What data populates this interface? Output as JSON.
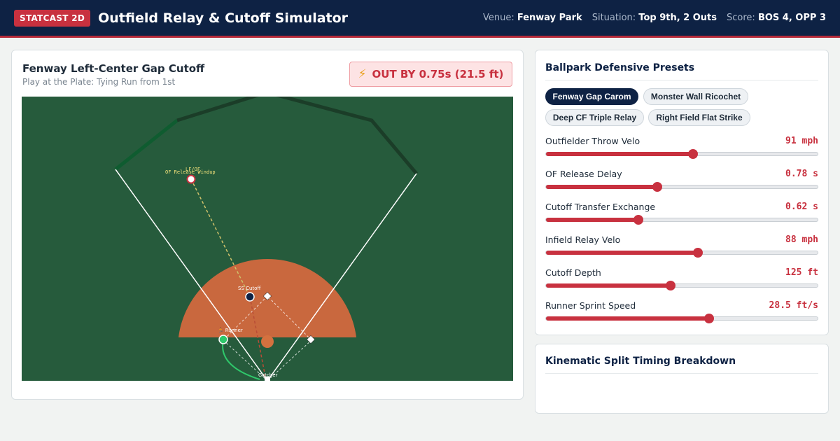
{
  "header": {
    "badge": "STATCAST 2D",
    "title": "Outfield Relay & Cutoff Simulator",
    "venue_label": "Venue:",
    "venue": "Fenway Park",
    "situation_label": "Situation:",
    "situation": "Top 9th, 2 Outs",
    "score_label": "Score:",
    "score": "BOS 4, OPP 3"
  },
  "play": {
    "title": "Fenway Left-Center Gap Cutoff",
    "subtitle": "Play at the Plate: Tying Run from 1st",
    "result": "OUT BY 0.75s (21.5 ft)",
    "result_icon": "lightning-icon"
  },
  "field": {
    "labels": {
      "of_release": "OF Release Windup",
      "lf_of": "LF/OF",
      "ss_cutoff": "SS Cutoff",
      "runner": "Runner",
      "catcher": "Catcher"
    },
    "colors": {
      "grass": "#265b3c",
      "dirt": "#c9683e",
      "wall": "#1b3d28",
      "monster": "#0f5c30",
      "runner_path": "#2fc86b",
      "throw_of": "#cfc06a",
      "throw_relay": "#b84c36"
    }
  },
  "presets": {
    "title": "Ballpark Defensive Presets",
    "items": [
      "Fenway Gap Carom",
      "Monster Wall Ricochet",
      "Deep CF Triple Relay",
      "Right Field Flat Strike"
    ],
    "active": "Fenway Gap Carom"
  },
  "sliders": [
    {
      "label": "Outfielder Throw Velo",
      "value": "91 mph",
      "fraction": 0.54
    },
    {
      "label": "OF Release Delay",
      "value": "0.78 s",
      "fraction": 0.41
    },
    {
      "label": "Cutoff Transfer Exchange",
      "value": "0.62 s",
      "fraction": 0.34
    },
    {
      "label": "Infield Relay Velo",
      "value": "88 mph",
      "fraction": 0.56
    },
    {
      "label": "Cutoff Depth",
      "value": "125 ft",
      "fraction": 0.46
    },
    {
      "label": "Runner Sprint Speed",
      "value": "28.5 ft/s",
      "fraction": 0.6
    }
  ],
  "timing": {
    "title": "Kinematic Split Timing Breakdown"
  }
}
